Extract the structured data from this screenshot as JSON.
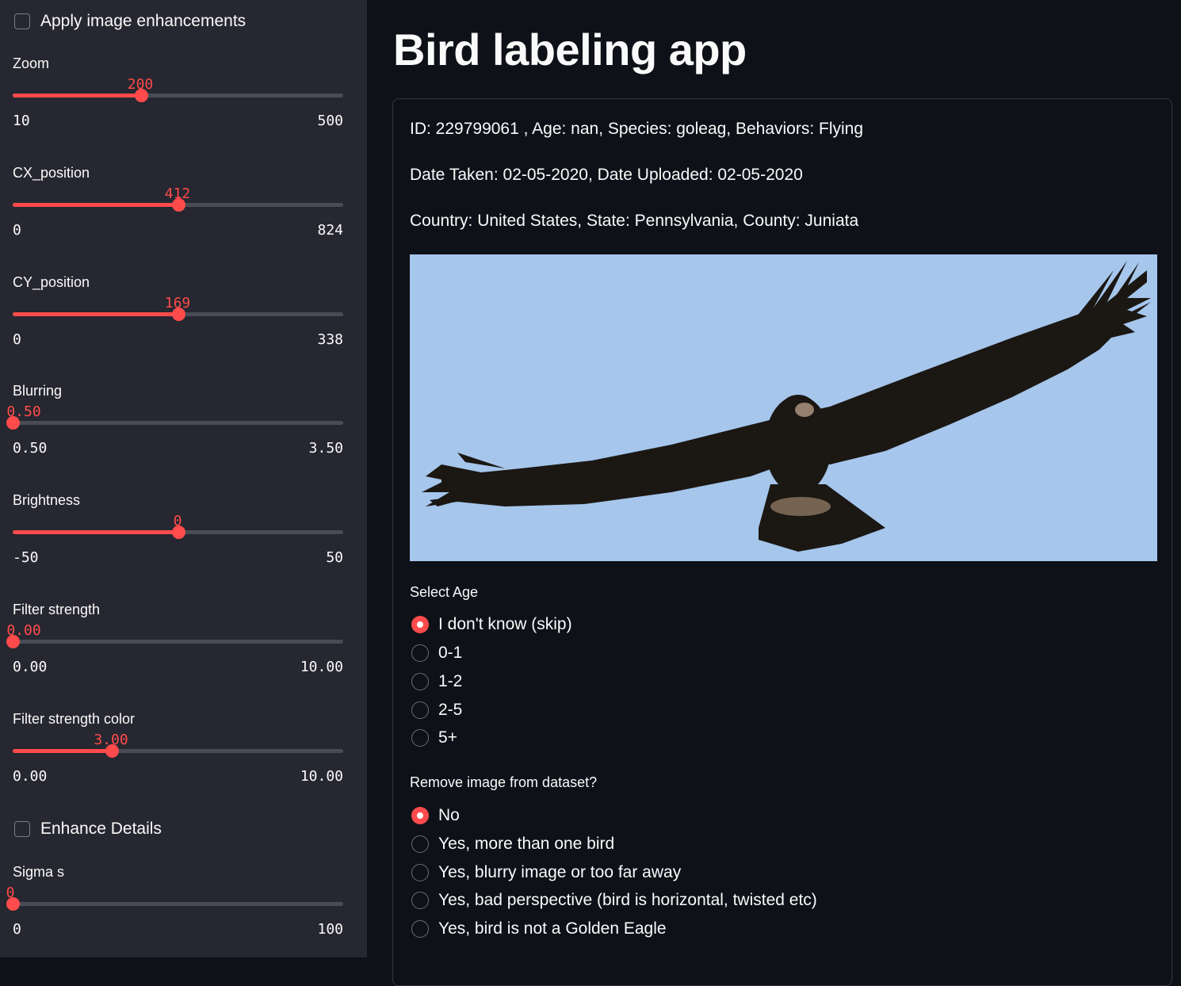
{
  "sidebar": {
    "apply_enhancements_label": "Apply image enhancements",
    "enhance_details_label": "Enhance Details",
    "sliders": [
      {
        "label": "Zoom",
        "value": "200",
        "min": "10",
        "max": "500",
        "fraction": 0.388
      },
      {
        "label": "CX_position",
        "value": "412",
        "min": "0",
        "max": "824",
        "fraction": 0.5
      },
      {
        "label": "CY_position",
        "value": "169",
        "min": "0",
        "max": "338",
        "fraction": 0.5
      },
      {
        "label": "Blurring",
        "value": "0.50",
        "min": "0.50",
        "max": "3.50",
        "fraction": 0.0
      },
      {
        "label": "Brightness",
        "value": "0",
        "min": "-50",
        "max": "50",
        "fraction": 0.5
      },
      {
        "label": "Filter strength",
        "value": "0.00",
        "min": "0.00",
        "max": "10.00",
        "fraction": 0.0
      },
      {
        "label": "Filter strength color",
        "value": "3.00",
        "min": "0.00",
        "max": "10.00",
        "fraction": 0.3
      },
      {
        "label": "Sigma s",
        "value": "0",
        "min": "0",
        "max": "100",
        "fraction": 0.0
      }
    ]
  },
  "main": {
    "title": "Bird labeling app",
    "info": {
      "line1": "ID: 229799061 , Age: nan, Species: goleag, Behaviors: Flying",
      "line2": "Date Taken: 02-05-2020, Date Uploaded: 02-05-2020",
      "line3": "Country: United States, State: Pennsylvania, County: Juniata"
    },
    "age": {
      "label": "Select Age",
      "options": [
        "I don't know (skip)",
        "0-1",
        "1-2",
        "2-5",
        "5+"
      ],
      "selected": "I don't know (skip)"
    },
    "remove": {
      "label": "Remove image from dataset?",
      "options": [
        "No",
        "Yes, more than one bird",
        "Yes, blurry image or too far away",
        "Yes, bad perspective (bird is horizontal, twisted etc)",
        "Yes, bird is not a Golden Eagle"
      ],
      "selected": "No"
    }
  },
  "colors": {
    "accent": "#ff4b4b",
    "sidebar_bg": "#262730",
    "main_bg": "#0e1117",
    "sky": "#a6c6ec"
  }
}
